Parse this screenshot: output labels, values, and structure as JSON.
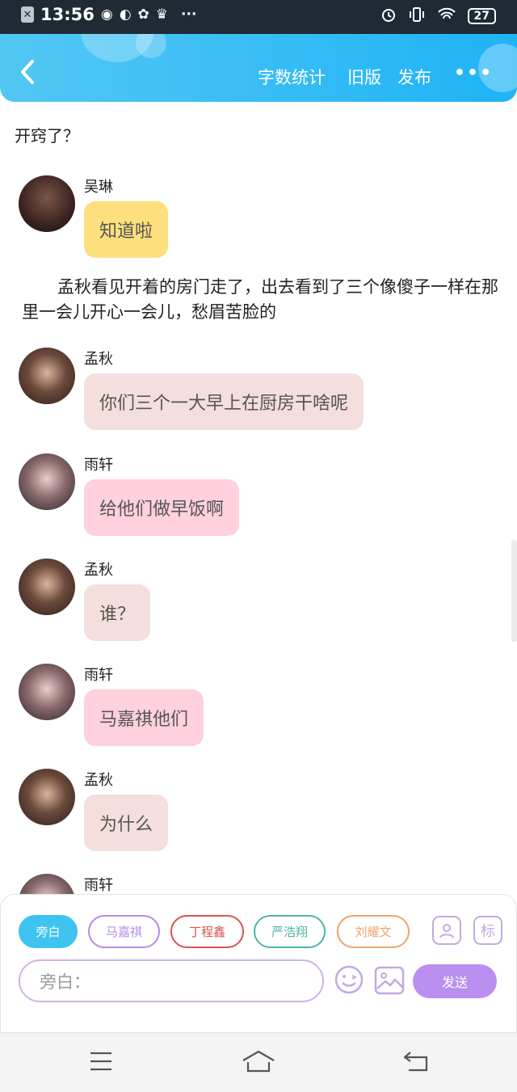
{
  "status_bar": {
    "time": "13:56",
    "left_icons": [
      "close-notification-icon",
      "wechat-icon",
      "browser-icon",
      "pinwheel-icon",
      "crown-icon",
      "more-dots-icon"
    ],
    "battery": "27",
    "right_icons": [
      "alarm-icon",
      "vibrate-icon",
      "wifi-icon",
      "battery-icon"
    ]
  },
  "header": {
    "back_icon": "chevron-left-icon",
    "word_count": "字数统计",
    "old_version": "旧版",
    "publish": "发布",
    "more_icon": "more-horizontal-icon"
  },
  "previous_text": "开窍了？",
  "messages": [
    {
      "name": "吴琳",
      "text": "知道啦",
      "bubble_color": "#fde07d",
      "avatar_color": "#3b2320"
    },
    {
      "narration": "孟秋看见开着的房门走了，出去看到了三个像傻子一样在那里一会儿开心一会儿，愁眉苦脸的"
    },
    {
      "name": "孟秋",
      "text": "你们三个一大早上在厨房干啥呢",
      "bubble_color": "#f4dede",
      "avatar_color": "#2a1d19"
    },
    {
      "name": "雨轩",
      "text": "给他们做早饭啊",
      "bubble_color": "#ffd0dd",
      "avatar_color": "#2c2325"
    },
    {
      "name": "孟秋",
      "text": "谁？",
      "bubble_color": "#f4dede",
      "avatar_color": "#2a1d19"
    },
    {
      "name": "雨轩",
      "text": "马嘉祺他们",
      "bubble_color": "#ffd0dd",
      "avatar_color": "#2c2325"
    },
    {
      "name": "孟秋",
      "text": "为什么",
      "bubble_color": "#f4dede",
      "avatar_color": "#2a1d19"
    },
    {
      "name": "雨轩",
      "avatar_color": "#2c2325"
    }
  ],
  "composer": {
    "roles": [
      {
        "label": "旁白",
        "color": "#3fc3f0",
        "filled": true
      },
      {
        "label": "马嘉祺",
        "color": "#b88be6",
        "filled": false
      },
      {
        "label": "丁程鑫",
        "color": "#d9534f",
        "filled": false
      },
      {
        "label": "严浩翔",
        "color": "#4fb3a9",
        "filled": false
      },
      {
        "label": "刘耀文",
        "color": "#f0a36b",
        "filled": false
      }
    ],
    "character_icon": "character-card-icon",
    "tag_label": "标",
    "input_placeholder": "旁白：",
    "emoji_icon": "emoji-icon",
    "image_icon": "image-icon",
    "send": "发送"
  },
  "nav_bar": {
    "icons": [
      "menu-icon",
      "home-icon",
      "back-icon"
    ]
  },
  "colors": {
    "header_start": "#52c7f3",
    "header_end": "#1fb3f6",
    "send_bg": "#ba8ff0"
  }
}
